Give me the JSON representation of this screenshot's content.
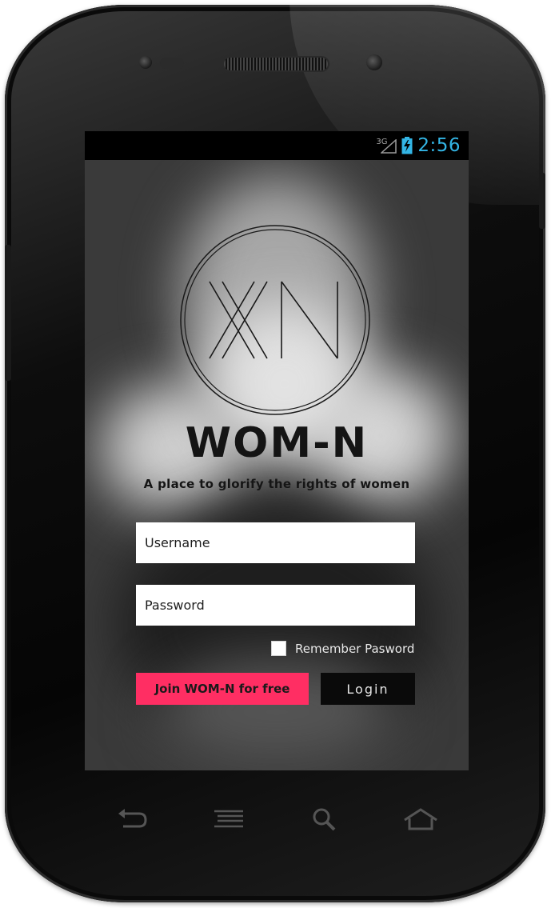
{
  "status_bar": {
    "network": "3G",
    "time": "2:56",
    "battery_icon": "battery-charging-icon",
    "signal_icon": "signal-icon"
  },
  "app": {
    "brand_name": "WOM-N",
    "tagline": "A place to glorify the rights of women",
    "logo_icon": "wom-n-monogram-logo",
    "username_placeholder": "Username",
    "password_placeholder": "Password",
    "remember_label": "Remember Pasword",
    "remember_checked": false,
    "join_label": "Join WOM-N for free",
    "login_label": "Login"
  },
  "nav_bar": {
    "icons": [
      "back-icon",
      "menu-icon",
      "search-icon",
      "home-icon"
    ]
  },
  "colors": {
    "accent": "#ff2e63",
    "clock": "#33b5e5",
    "login_button": "#0a0a0a",
    "field_background": "#ffffff"
  }
}
